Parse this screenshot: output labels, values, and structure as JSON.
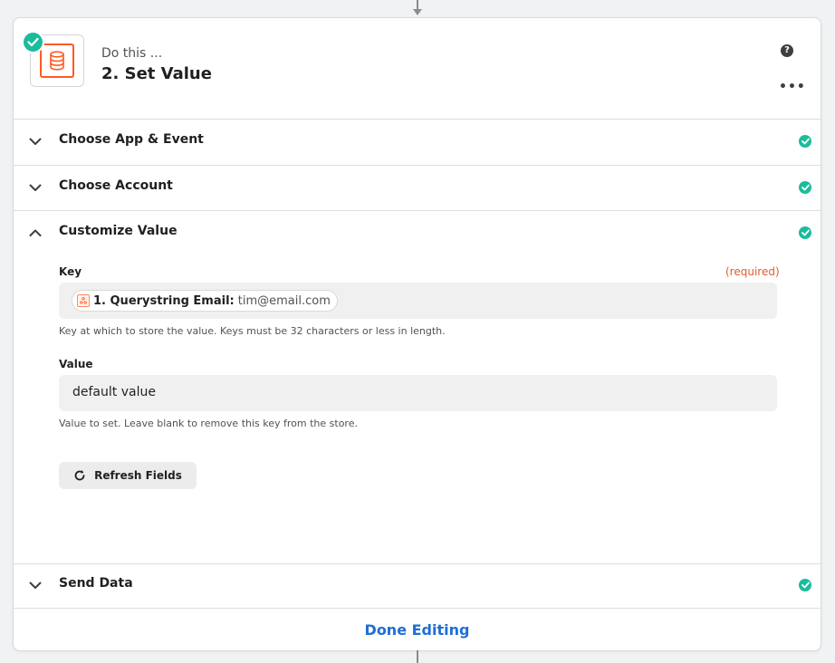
{
  "header": {
    "subtitle": "Do this ...",
    "title": "2. Set Value",
    "app_icon": "database-icon",
    "help_icon": "question-circle-icon",
    "help_glyph": "?",
    "more_icon": "more-horizontal-icon",
    "more_glyph": "•••"
  },
  "sections": [
    {
      "label": "Choose App & Event",
      "expanded": false,
      "complete": true
    },
    {
      "label": "Choose Account",
      "expanded": false,
      "complete": true
    },
    {
      "label": "Customize Value",
      "expanded": true,
      "complete": true
    },
    {
      "label": "Send Data",
      "expanded": false,
      "complete": true
    }
  ],
  "customize": {
    "key": {
      "label": "Key",
      "required_label": "(required)",
      "pill_name": "1. Querystring Email:",
      "pill_value": "tim@email.com",
      "pill_icon": "webhook-icon",
      "help": "Key at which to store the value. Keys must be 32 characters or less in length."
    },
    "value": {
      "label": "Value",
      "current": "default value",
      "help": "Value to set. Leave blank to remove this key from the store."
    },
    "refresh_button": {
      "label": "Refresh Fields",
      "icon": "refresh-icon"
    }
  },
  "footer": {
    "done_label": "Done Editing"
  },
  "colors": {
    "accent_blue": "#1f6ed4",
    "success_green": "#1bbc9b",
    "brand_orange": "#ff5a23",
    "required_red": "#e25c2f"
  }
}
